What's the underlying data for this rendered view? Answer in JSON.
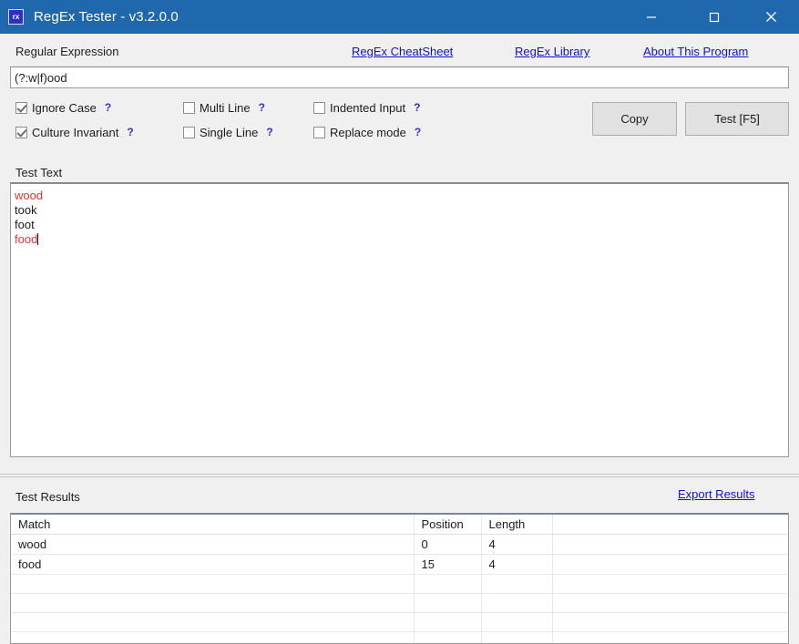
{
  "window": {
    "title": "RegEx Tester - v3.2.0.0",
    "icon_label": "rx",
    "icon_name": "regex-tester-icon",
    "accent_color": "#1f68ad",
    "controls": {
      "minimize": "minimize",
      "maximize": "maximize",
      "close": "close"
    }
  },
  "regex_section": {
    "label": "Regular Expression",
    "value": "(?:w|f)ood",
    "placeholder": "",
    "links": [
      {
        "label": "RegEx CheatSheet",
        "name": "regex-cheatsheet-link"
      },
      {
        "label": "RegEx Library",
        "name": "regex-library-link"
      },
      {
        "label": "About This Program",
        "name": "about-this-program-link"
      }
    ],
    "link_color": "#1111cc"
  },
  "options": [
    {
      "label": "Ignore Case",
      "checked": true,
      "help": "?"
    },
    {
      "label": "Culture Invariant",
      "checked": true,
      "help": "?"
    },
    {
      "label": "Multi Line",
      "checked": false,
      "help": "?"
    },
    {
      "label": "Single Line",
      "checked": false,
      "help": "?"
    },
    {
      "label": "Indented Input",
      "checked": false,
      "help": "?"
    },
    {
      "label": "Replace mode",
      "checked": false,
      "help": "?"
    }
  ],
  "buttons": {
    "copy": "Copy",
    "test": "Test [F5]"
  },
  "test_text": {
    "label": "Test Text",
    "match_color": "#f23030",
    "lines": [
      {
        "text": "wood",
        "match": true
      },
      {
        "text": "took",
        "match": false
      },
      {
        "text": "foot",
        "match": false
      },
      {
        "text": "food",
        "match": true
      }
    ]
  },
  "results": {
    "label": "Test Results",
    "export_link": "Export Results",
    "columns": [
      "Match",
      "Position",
      "Length",
      ""
    ],
    "rows": [
      [
        "wood",
        "0",
        "4",
        ""
      ],
      [
        "food",
        "15",
        "4",
        ""
      ],
      [
        "",
        "",
        "",
        ""
      ],
      [
        "",
        "",
        "",
        ""
      ],
      [
        "",
        "",
        "",
        ""
      ],
      [
        "",
        "",
        "",
        ""
      ]
    ]
  }
}
